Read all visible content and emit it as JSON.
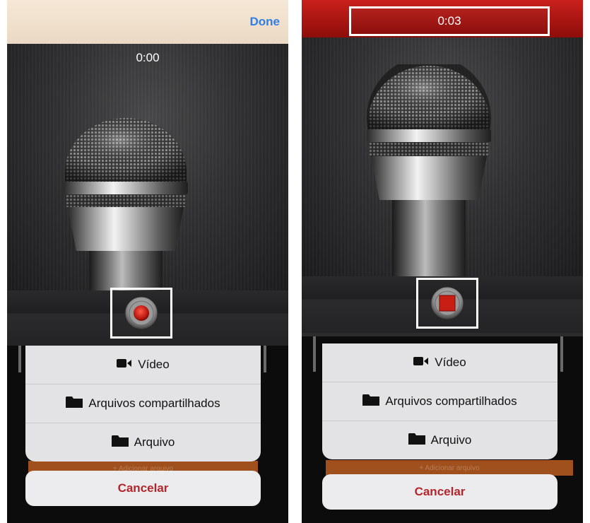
{
  "left_screen": {
    "done_label": "Done",
    "elapsed_time": "0:00",
    "record_state": "idle"
  },
  "right_screen": {
    "elapsed_time": "0:03",
    "record_state": "recording"
  },
  "sheet": {
    "items": [
      {
        "label": "Vídeo",
        "icon": "video-camera-icon"
      },
      {
        "label": "Arquivos compartilhados",
        "icon": "folder-icon"
      },
      {
        "label": "Arquivo",
        "icon": "folder-icon"
      }
    ],
    "partially_hidden_label": "+ Adicionar arquivo",
    "cancel_label": "Cancelar"
  },
  "colors": {
    "link_blue": "#2f7ee8",
    "recording_red": "#b3211d",
    "cancel_red": "#b5242b",
    "orange_bar": "#a0501c"
  }
}
